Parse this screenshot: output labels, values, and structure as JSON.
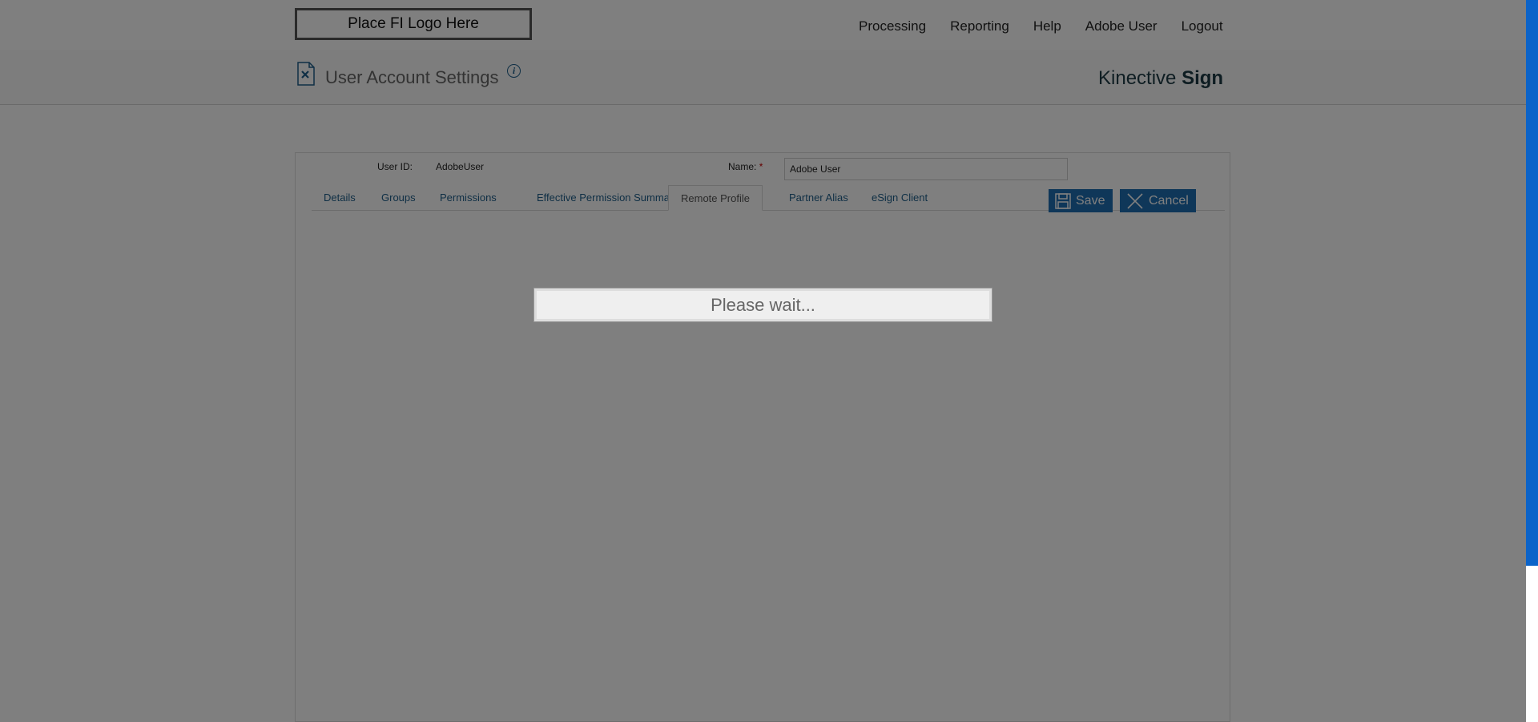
{
  "header": {
    "logo_text": "Place FI Logo Here",
    "nav": [
      "Processing",
      "Reporting",
      "Help",
      "Adobe User",
      "Logout"
    ]
  },
  "subheader": {
    "title": "User Account Settings",
    "info_icon": "i",
    "brand_light": "Kinective",
    "brand_bold": "Sign"
  },
  "form": {
    "user_id_label": "User ID:",
    "user_id_value": "AdobeUser",
    "name_label": "Name:",
    "name_required": "*",
    "name_value": "Adobe User"
  },
  "tabs": [
    "Details",
    "Groups",
    "Permissions",
    "Effective Permission Summary",
    "Remote Profile",
    "Partner Alias",
    "eSign Client"
  ],
  "active_tab": "Remote Profile",
  "buttons": {
    "save": "Save",
    "cancel": "Cancel"
  },
  "modal": {
    "message": "Please wait..."
  },
  "colors": {
    "accent": "#1f6fb2",
    "link": "#1f5f8b",
    "brand": "#1c3a44",
    "required": "#cc0000"
  }
}
